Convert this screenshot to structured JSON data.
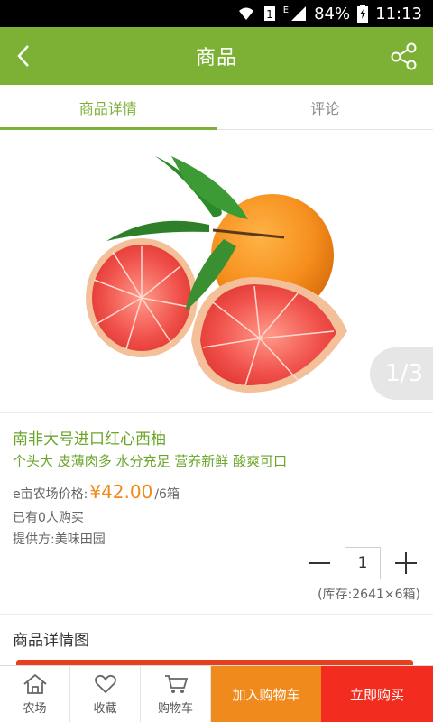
{
  "status": {
    "battery": "84%",
    "time": "11:13",
    "signal_letter": "E",
    "sim_badge": "1"
  },
  "header": {
    "title": "商品"
  },
  "tabs": [
    {
      "label": "商品详情",
      "active": true
    },
    {
      "label": "评论",
      "active": false
    }
  ],
  "gallery": {
    "pager": "1/3",
    "current_page": 1,
    "total_pages": 3
  },
  "product": {
    "name": "南非大号进口红心西柚",
    "slogan": "个头大 皮薄肉多 水分充足 营养新鲜 酸爽可口",
    "price_label": "e亩农场价格:",
    "price": "¥42.00",
    "unit": "/6箱",
    "sold": "已有0人购买",
    "supplier": "提供方:美味田园",
    "quantity": "1",
    "stock": "(库存:2641×6箱)"
  },
  "detail": {
    "title": "商品详情图"
  },
  "bottom_nav": {
    "farm": "农场",
    "favorite": "收藏",
    "cart": "购物车",
    "add_to_cart": "加入购物车",
    "buy_now": "立即购买"
  },
  "colors": {
    "brand_green": "#7cb135",
    "price_orange": "#f08a1c",
    "buy_red": "#f22c1e"
  }
}
